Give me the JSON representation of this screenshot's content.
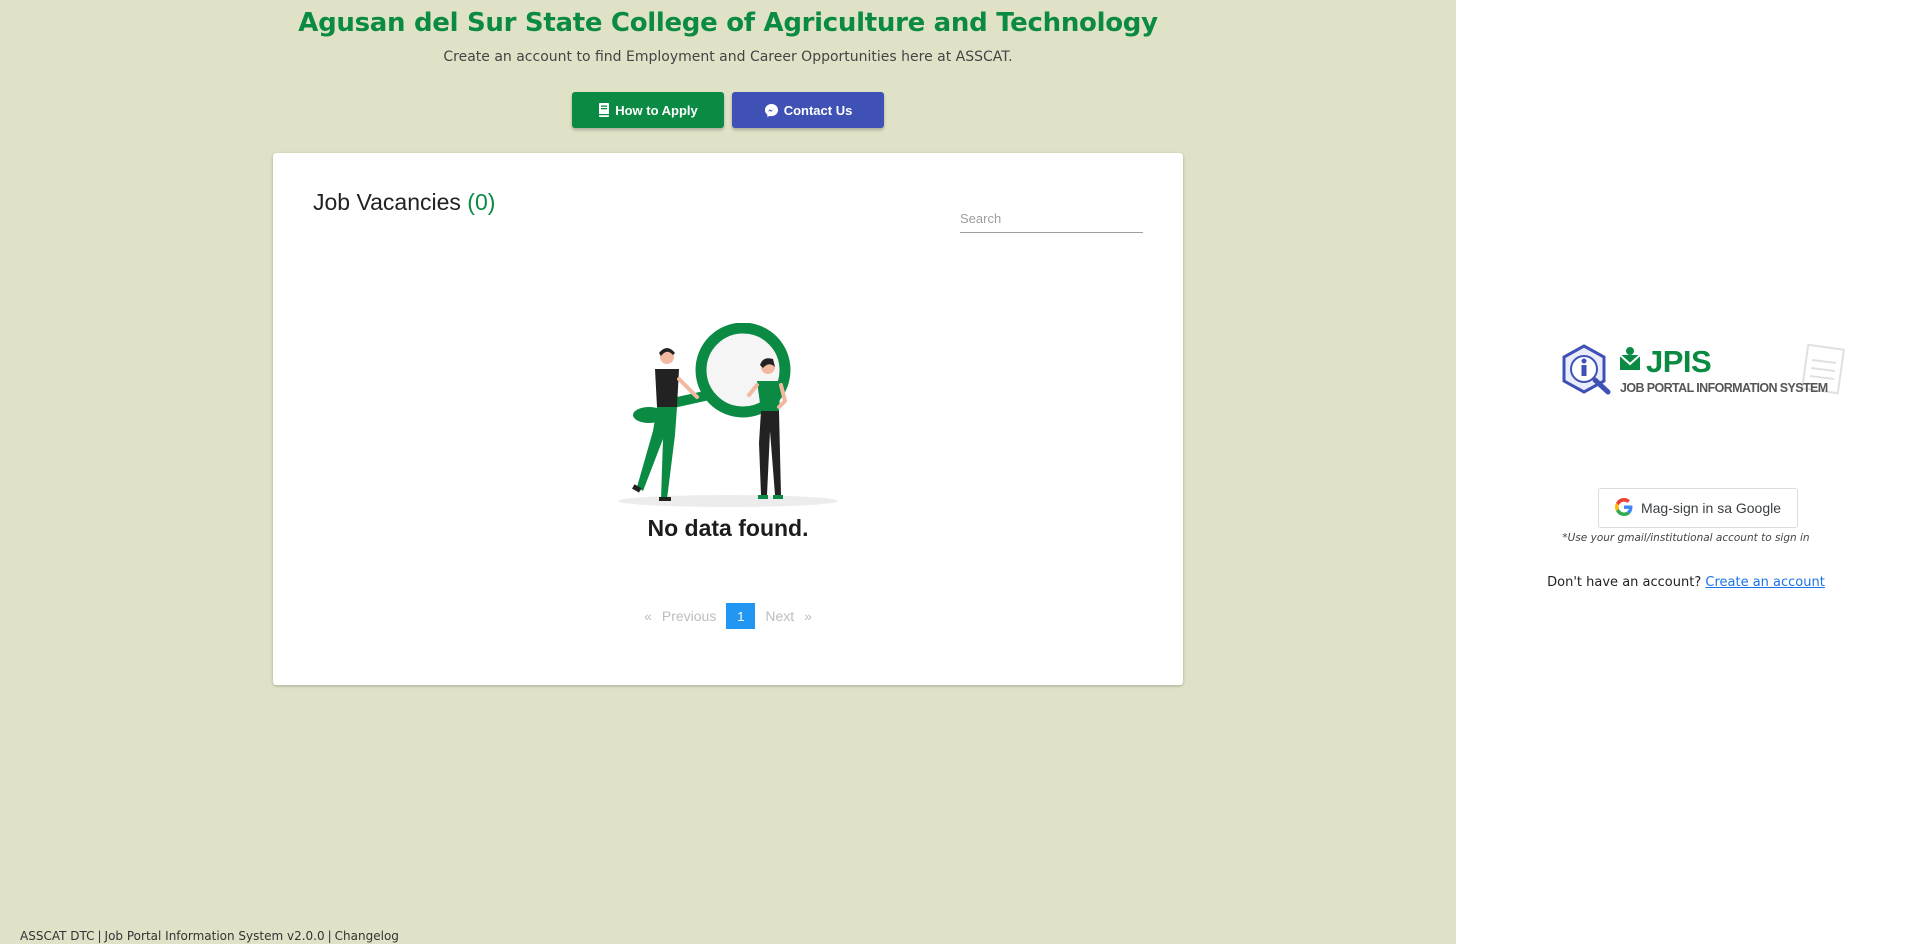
{
  "header": {
    "title": "Agusan del Sur State College of Agriculture and Technology",
    "subtitle": "Create an account to find Employment and Career Opportunities here at ASSCAT."
  },
  "actions": {
    "how_to_apply": {
      "label": "How to Apply",
      "icon": "book-icon",
      "color": "#0b8a43"
    },
    "contact_us": {
      "label": "Contact Us",
      "icon": "messenger-icon",
      "color": "#3f51b5"
    }
  },
  "vacancies": {
    "heading": "Job Vacancies",
    "count": "(0)",
    "search_placeholder": "Search",
    "empty_message": "No data found.",
    "illustration": "people-with-magnifying-glass"
  },
  "pagination": {
    "first_arrow": "«",
    "previous": "Previous",
    "current_page": "1",
    "next": "Next",
    "last_arrow": "»",
    "active_color": "#2196f3"
  },
  "footer": {
    "org": "ASSCAT DTC",
    "system": "Job Portal Information System v2.0.0",
    "changelog": "Changelog"
  },
  "sidebar": {
    "logo_title": "JPIS",
    "logo_subtitle": "JOB PORTAL INFORMATION SYSTEM",
    "google_button": "Mag-sign in sa Google",
    "google_note": "*Use your gmail/institutional account to sign in",
    "no_account_text": "Don't have an account?",
    "create_account_link": "Create an account"
  },
  "colors": {
    "brand_green": "#0b8a43",
    "background": "#e0e2c8"
  }
}
